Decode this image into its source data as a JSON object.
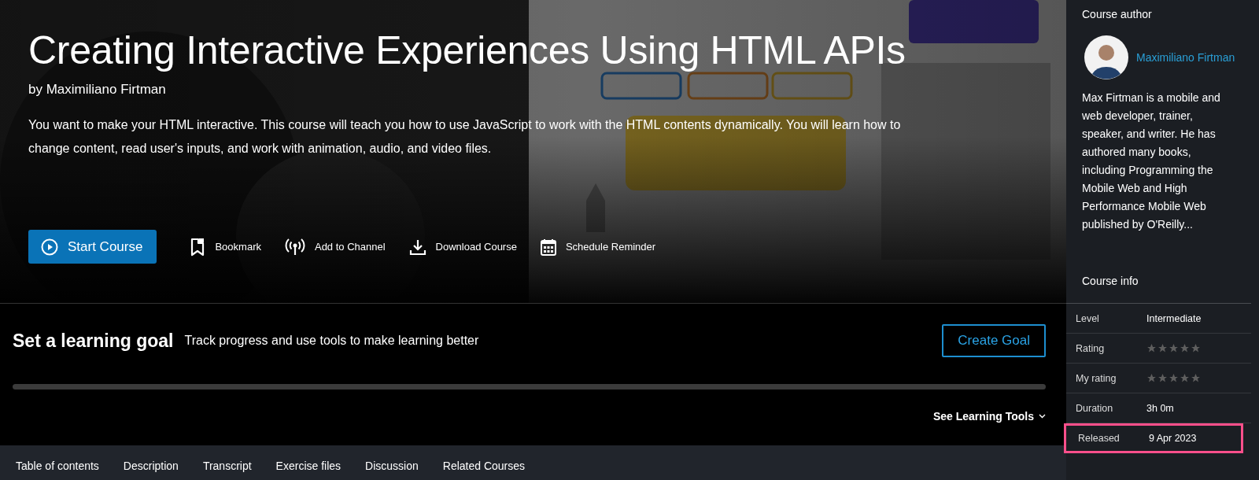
{
  "course": {
    "title": "Creating Interactive Experiences Using HTML APIs",
    "author_line": "by Maximiliano Firtman",
    "description": "You want to make your HTML interactive. This course will teach you how to use JavaScript to work with the HTML contents dynamically. You will learn how to change content, read user's inputs, and work with animation, audio, and video files."
  },
  "actions": {
    "primary": "Start Course",
    "items": [
      {
        "kind": "bookmark",
        "label": "Bookmark"
      },
      {
        "kind": "channel",
        "label": "Add to Channel"
      },
      {
        "kind": "download",
        "label": "Download Course"
      },
      {
        "kind": "calendar",
        "label": "Schedule Reminder"
      }
    ]
  },
  "goal": {
    "title": "Set a learning goal",
    "subtitle": "Track progress and use tools to make learning better",
    "button": "Create Goal",
    "progress": {
      "level": 0
    },
    "tools_link": "See Learning Tools"
  },
  "tabs": [
    {
      "label": "Table of contents",
      "selected": false
    },
    {
      "label": "Description",
      "selected": false
    },
    {
      "label": "Transcript",
      "selected": false
    },
    {
      "label": "Exercise files",
      "selected": false
    },
    {
      "label": "Discussion",
      "selected": false
    },
    {
      "label": "Related Courses",
      "selected": false
    }
  ],
  "sidebar": {
    "author_heading": "Course author",
    "author_name": "Maximiliano Firtman",
    "bio": "Max Firtman is a mobile and web developer, trainer, speaker, and writer. He has authored many books, including Programming the Mobile Web and High Performance Mobile Web published by O'Reilly...",
    "info_heading": "Course info",
    "info": [
      {
        "kind": "text",
        "label": "Level",
        "value": "Intermediate",
        "highlighted": false
      },
      {
        "kind": "stars",
        "label": "Rating",
        "stars": 0,
        "highlighted": false
      },
      {
        "kind": "stars",
        "label": "My rating",
        "stars": 0,
        "highlighted": false
      },
      {
        "kind": "text",
        "label": "Duration",
        "value": "3h 0m",
        "highlighted": false
      },
      {
        "kind": "text",
        "label": "Released",
        "value": "9 Apr 2023",
        "highlighted": true
      }
    ]
  }
}
